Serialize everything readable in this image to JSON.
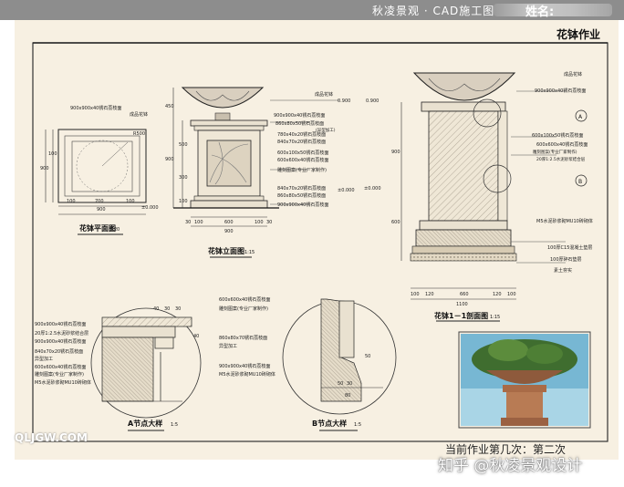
{
  "header": {
    "title": "秋凌景观 · CAD施工图班",
    "name_label": "姓名:"
  },
  "sheet": {
    "title": "花钵作业",
    "footnote": "当前作业第几次：第二次"
  },
  "views": {
    "plan": {
      "title": "花钵平面图",
      "scale": "1:20",
      "dims_top": [
        "900x900x40锈石荔枝面"
      ],
      "dims_bottom": [
        "100",
        "700",
        "100",
        "900"
      ],
      "dims_side": [
        "900",
        "100"
      ],
      "callouts": [
        "成品花钵",
        "R500"
      ],
      "level": "±0.000"
    },
    "elevation": {
      "title": "花钵立面图",
      "scale": "1:15",
      "callouts": [
        "成品花钵",
        "900x900x40锈石荔枝面",
        "860x80x50锈石荔枝面",
        "(异型加工)",
        "780x40x20锈石荔枝面",
        "840x70x20锈石荔枝面",
        "600x100x50锈石荔枝面",
        "600x600x40锈石荔枝面",
        "雕刻图案(专业厂家制作)",
        "840x70x20锈石荔枝面",
        "860x80x50锈石荔枝面",
        "900x900x40锈石荔枝面"
      ],
      "dims_left": [
        "450",
        "900",
        "500",
        "300",
        "100"
      ],
      "dims_bottom": [
        "30",
        "100",
        "600",
        "100",
        "30",
        "900"
      ],
      "levels": [
        "0.900",
        "±0.000"
      ]
    },
    "section": {
      "title": "花钵1－1剖面图",
      "scale": "1:15",
      "callouts": [
        "成品花钵",
        "900x900x40锈石荔枝面",
        "600x100x50锈石荔枝面",
        "600x600x40锈石荔枝面",
        "雕刻图案(专业厂家制作)",
        "20厚1:2.5水泥砂浆结合层",
        "M5水泥砂浆砌MU10砖砌体",
        "100厚C15混凝土垫层",
        "100厚碎石垫层",
        "素土夯实"
      ],
      "dims_left": [
        "900",
        "600"
      ],
      "dims_bottom": [
        "100",
        "120",
        "660",
        "120",
        "100",
        "1100"
      ],
      "levels": [
        "0.900",
        "±0.000"
      ],
      "markers": [
        "A",
        "B"
      ]
    },
    "detail_a": {
      "title": "A节点大样",
      "scale": "1:5",
      "callouts": [
        "900x900x40锈石荔枝面",
        "20厚1:2.5水泥砂浆结合层",
        "900x900x40锈石荔枝面",
        "840x70x20锈石荔枝面",
        "异型加工",
        "600x600x40锈石荔枝面",
        "雕刻图案(专业厂家制作)",
        "M5水泥砂浆砌MU10砖砌体"
      ],
      "dims": [
        "40",
        "30",
        "30",
        "40"
      ]
    },
    "detail_b": {
      "title": "B节点大样",
      "scale": "1:5",
      "callouts": [
        "600x600x40锈石荔枝面",
        "雕刻图案(专业厂家制作)",
        "860x80x70锈石荔枝面",
        "异型加工",
        "900x900x40锈石荔枝面",
        "M5水泥砂浆砌MU10砖砌体"
      ],
      "dims": [
        "50",
        "30",
        "50",
        "80"
      ]
    }
  },
  "watermarks": {
    "left": "QLJGW.COM",
    "right": "知乎 @秋凌景观设计"
  }
}
